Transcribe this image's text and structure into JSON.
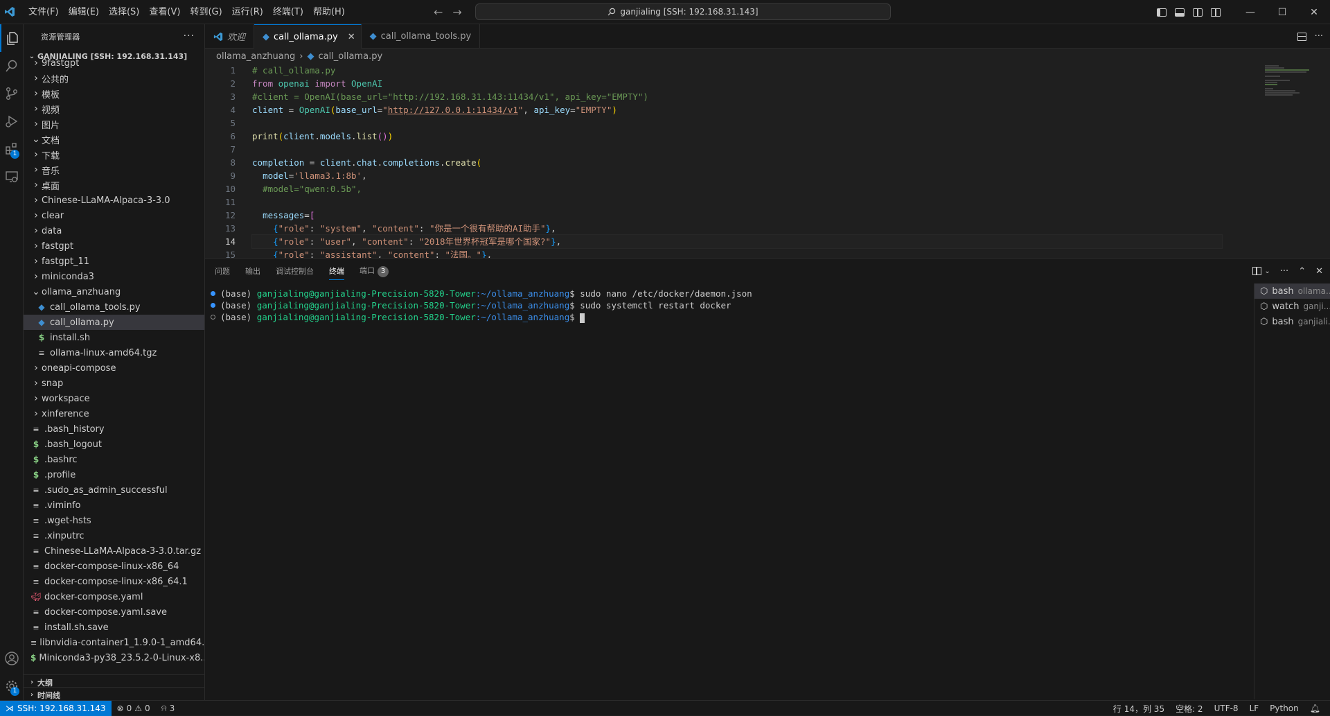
{
  "titlebar": {
    "menus": [
      "文件(F)",
      "编辑(E)",
      "选择(S)",
      "查看(V)",
      "转到(G)",
      "运行(R)",
      "终端(T)",
      "帮助(H)"
    ],
    "command_center": "ganjialing [SSH: 192.168.31.143]"
  },
  "activity": {
    "extensions_badge": "1",
    "settings_badge": "1"
  },
  "sidebar": {
    "title": "资源管理器",
    "workspace": "GANJIALING [SSH: 192.168.31.143]",
    "items": [
      {
        "label": "9fastgpt",
        "type": "folder",
        "indent": 1,
        "open": false
      },
      {
        "label": "公共的",
        "type": "folder",
        "indent": 1,
        "open": false
      },
      {
        "label": "模板",
        "type": "folder",
        "indent": 1,
        "open": false
      },
      {
        "label": "视频",
        "type": "folder",
        "indent": 1,
        "open": false
      },
      {
        "label": "图片",
        "type": "folder",
        "indent": 1,
        "open": false
      },
      {
        "label": "文档",
        "type": "folder",
        "indent": 1,
        "open": true
      },
      {
        "label": "下载",
        "type": "folder",
        "indent": 1,
        "open": false
      },
      {
        "label": "音乐",
        "type": "folder",
        "indent": 1,
        "open": false
      },
      {
        "label": "桌面",
        "type": "folder",
        "indent": 1,
        "open": false
      },
      {
        "label": "Chinese-LLaMA-Alpaca-3-3.0",
        "type": "folder",
        "indent": 1,
        "open": false
      },
      {
        "label": "clear",
        "type": "folder",
        "indent": 1,
        "open": false
      },
      {
        "label": "data",
        "type": "folder",
        "indent": 1,
        "open": false
      },
      {
        "label": "fastgpt",
        "type": "folder",
        "indent": 1,
        "open": false
      },
      {
        "label": "fastgpt_11",
        "type": "folder",
        "indent": 1,
        "open": false
      },
      {
        "label": "miniconda3",
        "type": "folder",
        "indent": 1,
        "open": false
      },
      {
        "label": "ollama_anzhuang",
        "type": "folder",
        "indent": 1,
        "open": true
      },
      {
        "label": "call_ollama_tools.py",
        "type": "py",
        "indent": 2
      },
      {
        "label": "call_ollama.py",
        "type": "py",
        "indent": 2,
        "selected": true
      },
      {
        "label": "install.sh",
        "type": "sh",
        "indent": 2
      },
      {
        "label": "ollama-linux-amd64.tgz",
        "type": "txt",
        "indent": 2
      },
      {
        "label": "oneapi-compose",
        "type": "folder",
        "indent": 1,
        "open": false
      },
      {
        "label": "snap",
        "type": "folder",
        "indent": 1,
        "open": false
      },
      {
        "label": "workspace",
        "type": "folder",
        "indent": 1,
        "open": false
      },
      {
        "label": "xinference",
        "type": "folder",
        "indent": 1,
        "open": false
      },
      {
        "label": ".bash_history",
        "type": "txt",
        "indent": 1
      },
      {
        "label": ".bash_logout",
        "type": "sh",
        "indent": 1
      },
      {
        "label": ".bashrc",
        "type": "sh",
        "indent": 1
      },
      {
        "label": ".profile",
        "type": "sh",
        "indent": 1
      },
      {
        "label": ".sudo_as_admin_successful",
        "type": "txt",
        "indent": 1
      },
      {
        "label": ".viminfo",
        "type": "txt",
        "indent": 1
      },
      {
        "label": ".wget-hsts",
        "type": "txt",
        "indent": 1
      },
      {
        "label": ".xinputrc",
        "type": "txt",
        "indent": 1
      },
      {
        "label": "Chinese-LLaMA-Alpaca-3-3.0.tar.gz",
        "type": "txt",
        "indent": 1
      },
      {
        "label": "docker-compose-linux-x86_64",
        "type": "txt",
        "indent": 1
      },
      {
        "label": "docker-compose-linux-x86_64.1",
        "type": "txt",
        "indent": 1
      },
      {
        "label": "docker-compose.yaml",
        "type": "docker",
        "indent": 1
      },
      {
        "label": "docker-compose.yaml.save",
        "type": "txt",
        "indent": 1
      },
      {
        "label": "install.sh.save",
        "type": "txt",
        "indent": 1
      },
      {
        "label": "libnvidia-container1_1.9.0-1_amd64....",
        "type": "txt",
        "indent": 1
      },
      {
        "label": "Miniconda3-py38_23.5.2-0-Linux-x8...",
        "type": "sh",
        "indent": 1
      }
    ],
    "outline_label": "大纲",
    "timeline_label": "时间线"
  },
  "tabs": [
    {
      "label": "欢迎",
      "icon": "vscode-icon",
      "italic": true,
      "active": false
    },
    {
      "label": "call_ollama.py",
      "icon": "python-icon",
      "active": true,
      "closable": true
    },
    {
      "label": "call_ollama_tools.py",
      "icon": "python-icon",
      "active": false
    }
  ],
  "breadcrumb": {
    "folder": "ollama_anzhuang",
    "file": "call_ollama.py"
  },
  "editor": {
    "current_line": 14,
    "line_numbers": [
      "1",
      "2",
      "3",
      "4",
      "5",
      "6",
      "7",
      "8",
      "9",
      "10",
      "11",
      "12",
      "13",
      "14",
      "15"
    ]
  },
  "panel": {
    "tabs": [
      "问题",
      "输出",
      "调试控制台",
      "终端",
      "端口"
    ],
    "active_tab": "终端",
    "ports_count": "3",
    "terminal_lines": [
      {
        "prefix": "(base) ",
        "user": "ganjialing@ganjialing-Precision-5820-Tower",
        "path": ":~/ollama_anzhuang",
        "cmd": "$ sudo nano /etc/docker/daemon.json",
        "dot": "filled"
      },
      {
        "prefix": "(base) ",
        "user": "ganjialing@ganjialing-Precision-5820-Tower",
        "path": ":~/ollama_anzhuang",
        "cmd": "$ sudo systemctl restart docker",
        "dot": "filled"
      },
      {
        "prefix": "(base) ",
        "user": "ganjialing@ganjialing-Precision-5820-Tower",
        "path": ":~/ollama_anzhuang",
        "cmd": "$ ",
        "dot": "hollow"
      }
    ],
    "terminals": [
      {
        "name": "bash",
        "sub": "ollama..."
      },
      {
        "name": "watch",
        "sub": "ganji..."
      },
      {
        "name": "bash",
        "sub": "ganjiali..."
      }
    ]
  },
  "statusbar": {
    "remote": "SSH: 192.168.31.143",
    "errors": "0",
    "warnings": "0",
    "ports": "3",
    "position": "行 14，列 35",
    "spaces": "空格: 2",
    "encoding": "UTF-8",
    "eol": "LF",
    "language": "Python"
  }
}
